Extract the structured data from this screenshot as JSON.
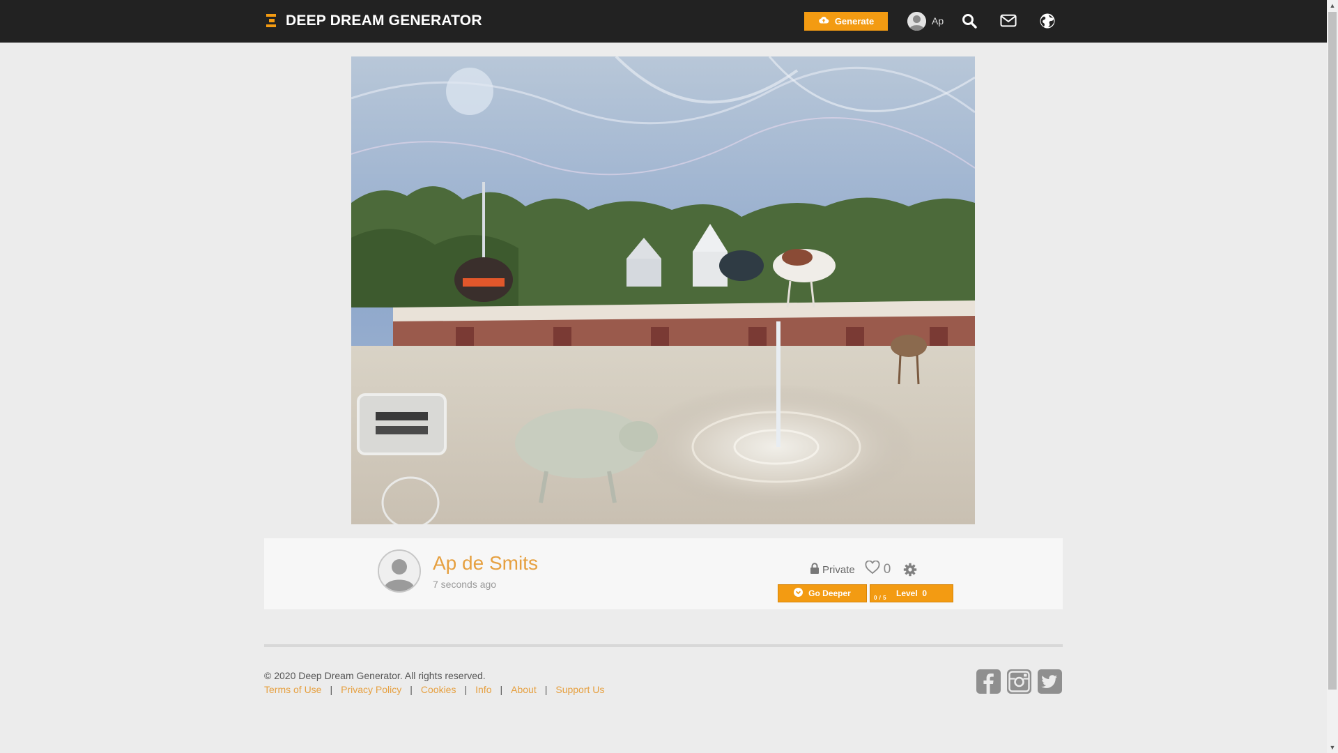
{
  "header": {
    "brand": "DEEP DREAM GENERATOR",
    "generate_label": "Generate",
    "user_name": "Ap"
  },
  "dream": {
    "author": "Ap de Smits",
    "time_ago": "7 seconds ago",
    "privacy": "Private",
    "likes": "0",
    "go_deeper_label": "Go Deeper",
    "level_label": "Level  0",
    "level_count": "0 / 5"
  },
  "footer": {
    "copyright": "© 2020 Deep Dream Generator. All rights reserved.",
    "links": {
      "terms": "Terms of Use",
      "privacy": "Privacy Policy",
      "cookies": "Cookies",
      "info": "Info",
      "about": "About",
      "support": "Support Us"
    },
    "separator": "|"
  },
  "icons": {
    "logo": "ddg-logo-icon",
    "generate": "cloud-upload-icon",
    "search": "search-icon",
    "mail": "envelope-icon",
    "globe": "globe-icon",
    "lock": "lock-icon",
    "heart": "heart-icon",
    "settings": "gear-icon",
    "deeper": "chevron-circle-down-icon",
    "facebook": "facebook-icon",
    "instagram": "instagram-icon",
    "twitter": "twitter-icon"
  },
  "colors": {
    "accent": "#f39b12",
    "link": "#e6a040",
    "header_bg": "#222222",
    "page_bg": "#ececec"
  }
}
